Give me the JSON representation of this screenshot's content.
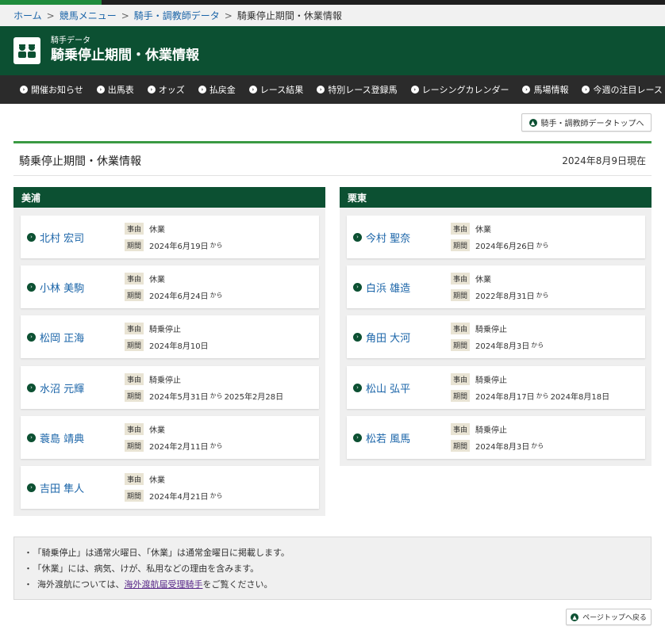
{
  "breadcrumb": {
    "items": [
      "ホーム",
      "競馬メニュー",
      "騎手・調教師データ"
    ],
    "current": "騎乗停止期間・休業情報"
  },
  "header": {
    "subtitle": "騎手データ",
    "title": "騎乗停止期間・休業情報"
  },
  "nav": {
    "items": [
      "開催お知らせ",
      "出馬表",
      "オッズ",
      "払戻金",
      "レース結果",
      "特別レース登録馬",
      "レーシングカレンダー",
      "馬場情報",
      "今週の注目レース"
    ]
  },
  "top_link": "騎手・調教師データトップへ",
  "page": {
    "heading": "騎乗停止期間・休業情報",
    "as_of": "2024年8月9日現在"
  },
  "labels": {
    "reason": "事由",
    "period": "期間",
    "kara": "から"
  },
  "miho": {
    "title": "美浦",
    "jockeys": [
      {
        "name": "北村 宏司",
        "reason": "休業",
        "start": "2024年6月19日",
        "kara1": "から",
        "end": "",
        "kara2": ""
      },
      {
        "name": "小林 美駒",
        "reason": "休業",
        "start": "2024年6月24日",
        "kara1": "から",
        "end": "",
        "kara2": ""
      },
      {
        "name": "松岡 正海",
        "reason": "騎乗停止",
        "start": "2024年8月10日",
        "kara1": "",
        "end": "",
        "kara2": ""
      },
      {
        "name": "水沼 元輝",
        "reason": "騎乗停止",
        "start": "2024年5月31日",
        "kara1": "から",
        "end": "2025年2月28日",
        "kara2": ""
      },
      {
        "name": "蓑島 靖典",
        "reason": "休業",
        "start": "2024年2月11日",
        "kara1": "から",
        "end": "",
        "kara2": ""
      },
      {
        "name": "吉田 隼人",
        "reason": "休業",
        "start": "2024年4月21日",
        "kara1": "から",
        "end": "",
        "kara2": ""
      }
    ]
  },
  "ritto": {
    "title": "栗東",
    "jockeys": [
      {
        "name": "今村 聖奈",
        "reason": "休業",
        "start": "2024年6月26日",
        "kara1": "から",
        "end": "",
        "kara2": ""
      },
      {
        "name": "白浜 雄造",
        "reason": "休業",
        "start": "2022年8月31日",
        "kara1": "から",
        "end": "",
        "kara2": ""
      },
      {
        "name": "角田 大河",
        "reason": "騎乗停止",
        "start": "2024年8月3日",
        "kara1": "から",
        "end": "",
        "kara2": ""
      },
      {
        "name": "松山 弘平",
        "reason": "騎乗停止",
        "start": "2024年8月17日",
        "kara1": "から",
        "end": "2024年8月18日",
        "kara2": ""
      },
      {
        "name": "松若 風馬",
        "reason": "騎乗停止",
        "start": "2024年8月3日",
        "kara1": "から",
        "end": "",
        "kara2": ""
      }
    ]
  },
  "notes": {
    "bullet": "・",
    "line1": "「騎乗停止」は通常火曜日、「休業」は通常金曜日に掲載します。",
    "line2": "「休業」には、病気、けが、私用などの理由を含みます。",
    "line3_pre": "海外渡航については、",
    "line3_link": "海外渡航届受理騎手",
    "line3_post": "をご覧ください。"
  },
  "back_top": "ページトップへ戻る",
  "colors": {
    "header_green": "#0c5032",
    "accent_green": "#3a9a43",
    "link_blue": "#1a64a8",
    "nav_dark": "#2b2b2b"
  }
}
